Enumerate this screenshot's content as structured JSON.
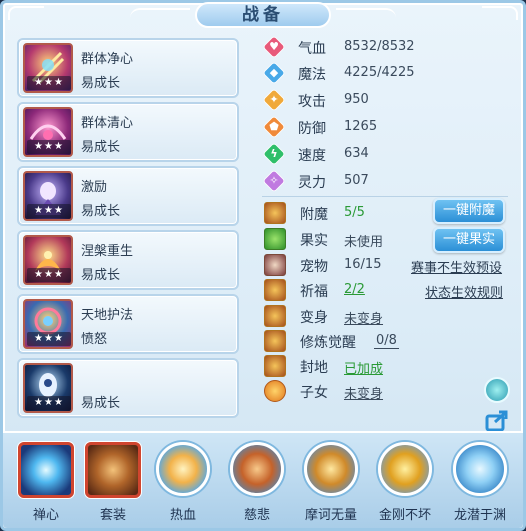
{
  "window": {
    "title": "战备"
  },
  "cards": [
    {
      "name": "群体净心",
      "sub": "易成长",
      "stars": "★★★",
      "icon": "spell-scroll-icon"
    },
    {
      "name": "群体清心",
      "sub": "易成长",
      "stars": "★★★",
      "icon": "spell-scroll-icon"
    },
    {
      "name": "激励",
      "sub": "易成长",
      "stars": "★★★",
      "icon": "spell-scroll-icon"
    },
    {
      "name": "涅槃重生",
      "sub": "易成长",
      "stars": "★★★",
      "icon": "spell-scroll-icon"
    },
    {
      "name": "天地护法",
      "sub": "愤怒",
      "stars": "★★★",
      "icon": "spell-scroll-icon"
    },
    {
      "name": "",
      "sub": "易成长",
      "stars": "★★★",
      "icon": "spell-scroll-icon"
    }
  ],
  "stats": [
    {
      "label": "气血",
      "value": "8532/8532",
      "color": "#e85a7a",
      "glyph": "♥",
      "icon": "heart-gem-icon"
    },
    {
      "label": "魔法",
      "value": "4225/4225",
      "color": "#49a9e8",
      "glyph": "◆",
      "icon": "mana-gem-icon"
    },
    {
      "label": "攻击",
      "value": "950",
      "color": "#f0a93a",
      "glyph": "✦",
      "icon": "attack-gem-icon"
    },
    {
      "label": "防御",
      "value": "1265",
      "color": "#f08a3a",
      "glyph": "⬟",
      "icon": "shield-gem-icon"
    },
    {
      "label": "速度",
      "value": "634",
      "color": "#2fbf6a",
      "glyph": "ϟ",
      "icon": "speed-gem-icon"
    },
    {
      "label": "灵力",
      "value": "507",
      "color": "#c07ae0",
      "glyph": "✧",
      "icon": "spirit-gem-icon"
    }
  ],
  "equip": {
    "enchant": {
      "label": "附魔",
      "value": "5/5"
    },
    "fruit": {
      "label": "果实",
      "value": "未使用"
    },
    "pet": {
      "label": "宠物",
      "value": "16/15"
    },
    "blessing": {
      "label": "祈福",
      "value": "2/2"
    },
    "transform": {
      "label": "变身",
      "value": "未变身"
    },
    "awaken": {
      "label": "修炼觉醒",
      "value": "0/8"
    },
    "seal": {
      "label": "封地",
      "value": "已加成"
    },
    "child": {
      "label": "子女",
      "value": "未变身"
    }
  },
  "buttons": {
    "one_click_enchant": "一键附魔",
    "one_click_fruit": "一键果实",
    "preset_link": "赛事不生效预设",
    "rules_link": "状态生效规则"
  },
  "skills": [
    {
      "label": "禅心",
      "icon": "zen-orb-icon",
      "style": "square"
    },
    {
      "label": "套装",
      "icon": "bronze-suit-icon",
      "style": "square"
    },
    {
      "label": "热血",
      "icon": "hot-blood-icon",
      "style": "circle"
    },
    {
      "label": "慈悲",
      "icon": "mercy-scroll-icon",
      "style": "circle"
    },
    {
      "label": "摩诃无量",
      "icon": "monk-icon",
      "style": "circle"
    },
    {
      "label": "金刚不坏",
      "icon": "golden-buddha-icon",
      "style": "circle"
    },
    {
      "label": "龙潜于渊",
      "icon": "dragon-icon",
      "style": "circle"
    }
  ],
  "colors": {
    "accent_blue": "#2b8fd6",
    "green_value": "#2a9a36",
    "card_border_red": "#d0452f"
  }
}
